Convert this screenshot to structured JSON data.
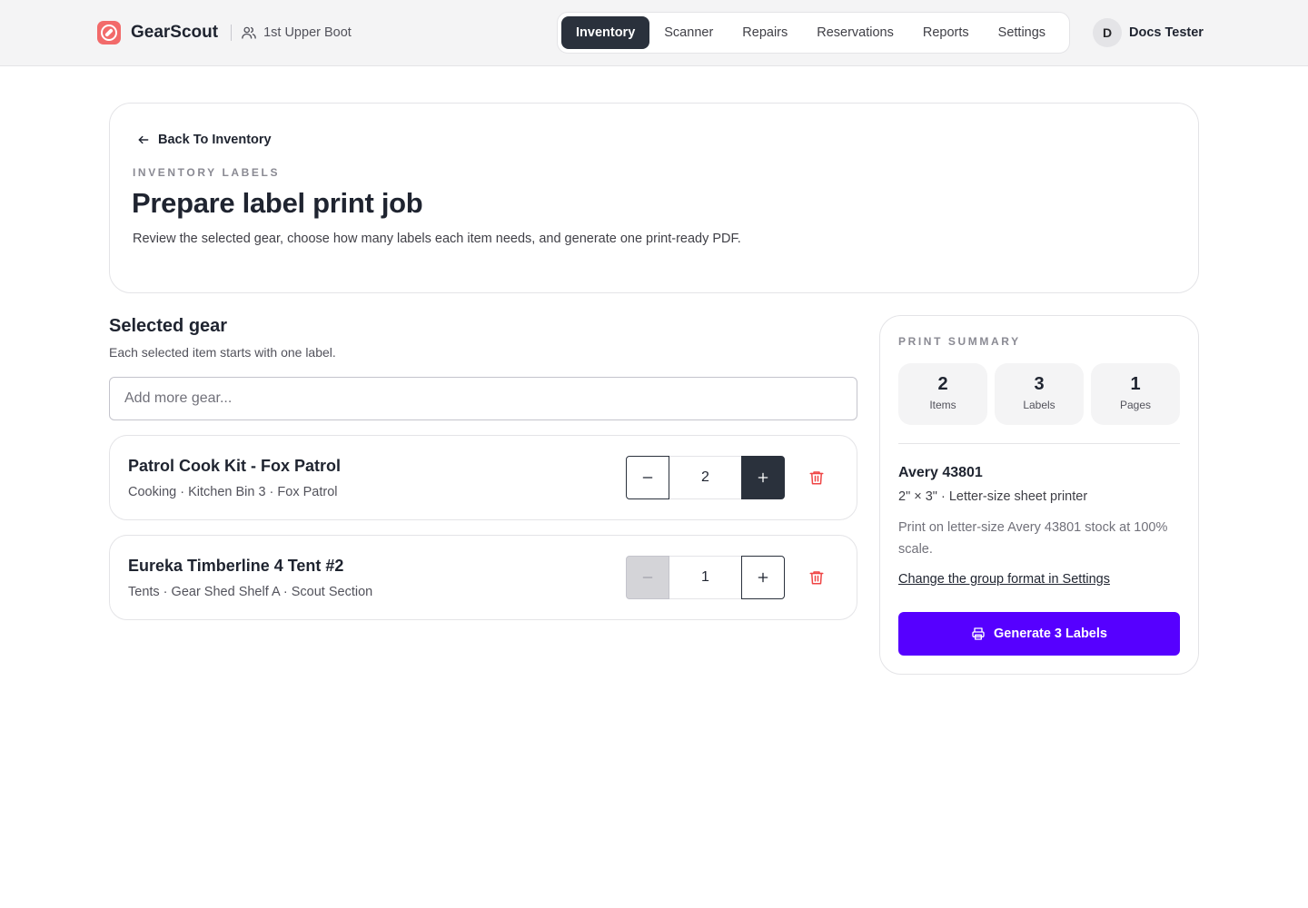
{
  "app": {
    "brand": "GearScout",
    "group": "1st Upper Boot",
    "user_initial": "D",
    "user_name": "Docs Tester"
  },
  "nav": {
    "items": [
      {
        "label": "Inventory",
        "active": true
      },
      {
        "label": "Scanner"
      },
      {
        "label": "Repairs"
      },
      {
        "label": "Reservations"
      },
      {
        "label": "Reports"
      },
      {
        "label": "Settings"
      }
    ]
  },
  "header": {
    "back_label": "Back To Inventory",
    "eyebrow": "INVENTORY LABELS",
    "title": "Prepare label print job",
    "description": "Review the selected gear, choose how many labels each item needs, and generate one print-ready PDF."
  },
  "selected": {
    "title": "Selected gear",
    "subtitle": "Each selected item starts with one label.",
    "search_placeholder": "Add more gear...",
    "items": [
      {
        "name": "Patrol Cook Kit - Fox Patrol",
        "meta": "Cooking · Kitchen Bin 3 · Fox Patrol",
        "quantity": "2"
      },
      {
        "name": "Eureka Timberline 4 Tent #2",
        "meta": "Tents · Gear Shed Shelf A · Scout Section",
        "quantity": "1"
      }
    ]
  },
  "summary": {
    "eyebrow": "PRINT SUMMARY",
    "stats": [
      {
        "value": "2",
        "label": "Items"
      },
      {
        "value": "3",
        "label": "Labels"
      },
      {
        "value": "1",
        "label": "Pages"
      }
    ],
    "format_name": "Avery 43801",
    "format_spec": "2\" × 3\" · Letter-size sheet printer",
    "format_note": "Print on letter-size Avery 43801 stock at 100% scale.",
    "settings_link": "Change the group format in Settings",
    "generate_label": "Generate 3 Labels"
  },
  "colors": {
    "accent": "#5600ff",
    "dark": "#2a313c",
    "danger": "#ef4444",
    "logo": "#f26a6a"
  },
  "icons": {
    "logo": "compass-icon",
    "group": "users-icon",
    "back": "arrow-left-icon",
    "delete": "trash-icon",
    "print": "printer-icon"
  }
}
